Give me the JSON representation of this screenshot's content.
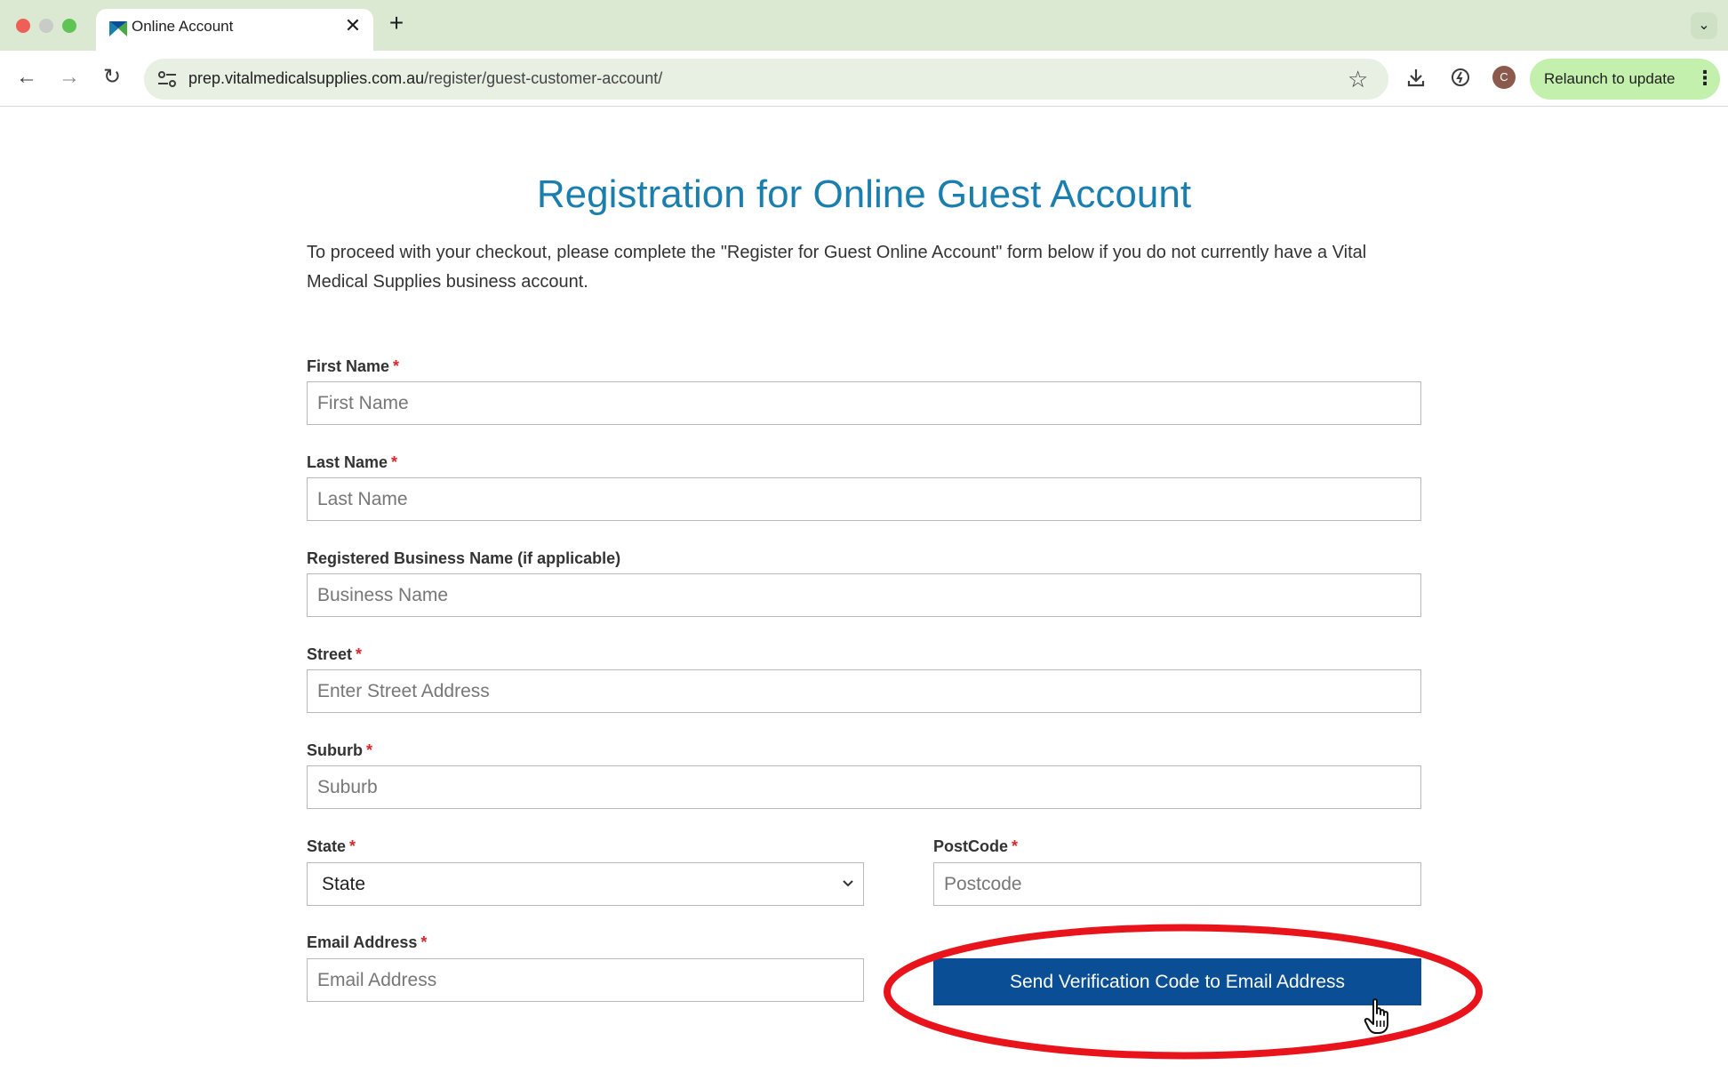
{
  "browser": {
    "tab": {
      "title": "Online Account",
      "close_glyph": "✕"
    },
    "new_tab_glyph": "+",
    "tab_menu_glyph": "⌄",
    "nav": {
      "back_glyph": "←",
      "forward_glyph": "→",
      "reload_glyph": "↻"
    },
    "url": {
      "host": "prep.vitalmedicalsupplies.com.au",
      "path": "/register/guest-customer-account/"
    },
    "star_glyph": "☆",
    "profile_initial": "C",
    "relaunch": {
      "label": "Relaunch to update",
      "menu_glyph": "⋮"
    }
  },
  "page": {
    "title": "Registration for Online Guest Account",
    "intro": "To proceed with your checkout, please complete the \"Register for Guest Online Account\" form below if you do not currently have a Vital Medical Supplies business account.",
    "required_marker": "*",
    "form": {
      "first_name": {
        "label": "First Name",
        "placeholder": "First Name"
      },
      "last_name": {
        "label": "Last Name",
        "placeholder": "Last Name"
      },
      "business_name": {
        "label": "Registered Business Name (if applicable)",
        "placeholder": "Business Name"
      },
      "street": {
        "label": "Street",
        "placeholder": "Enter Street Address"
      },
      "suburb": {
        "label": "Suburb",
        "placeholder": "Suburb"
      },
      "state": {
        "label": "State",
        "selected": "State",
        "chevron_glyph": "⌄"
      },
      "postcode": {
        "label": "PostCode",
        "placeholder": "Postcode"
      },
      "email": {
        "label": "Email Address",
        "placeholder": "Email Address"
      },
      "send_button": "Send Verification Code to Email Address"
    }
  },
  "colors": {
    "title_blue": "#1a7fae",
    "button_blue": "#0a4f96",
    "required_red": "#d9262c",
    "annotation_red": "#e8131b",
    "tabstrip_green": "#dbe9d3",
    "relaunch_green": "#c3f1ad"
  },
  "icons": {
    "tab_favicon": "vital-medical-logo-icon",
    "site_info": "tune-icon",
    "download": "download-icon",
    "extension": "performance-icon",
    "cursor": "hand-pointer-icon"
  }
}
